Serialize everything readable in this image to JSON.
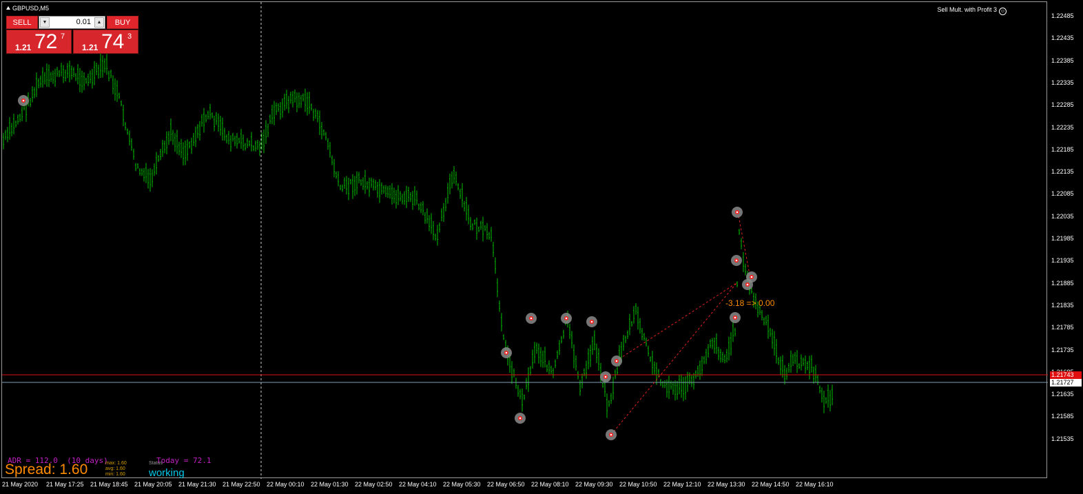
{
  "window": {
    "symbol_title": "GBPUSD,M5",
    "ea_label": "Sell Mult. with Profit 3",
    "ea_icon": "smiley-icon"
  },
  "trade_panel": {
    "sell_label": "SELL",
    "buy_label": "BUY",
    "lot_value": "0.01",
    "sell_price": {
      "prefix": "1.21",
      "big": "72",
      "sup": "7"
    },
    "buy_price": {
      "prefix": "1.21",
      "big": "74",
      "sup": "3"
    },
    "colors": {
      "button": "#e0262c"
    }
  },
  "price_axis": {
    "ticks": [
      "1.22485",
      "1.22435",
      "1.22385",
      "1.22335",
      "1.22285",
      "1.22235",
      "1.22185",
      "1.22135",
      "1.22085",
      "1.22035",
      "1.21985",
      "1.21935",
      "1.21885",
      "1.21835",
      "1.21785",
      "1.21735",
      "1.21685",
      "1.21635",
      "1.21585",
      "1.21535"
    ],
    "bid_line_label": "1.21743",
    "ask_line_label": "1.21727"
  },
  "time_axis": {
    "ticks": [
      "21 May 2020",
      "21 May 17:25",
      "21 May 18:45",
      "21 May 20:05",
      "21 May 21:30",
      "21 May 22:50",
      "22 May 00:10",
      "22 May 01:30",
      "22 May 02:50",
      "22 May 04:10",
      "22 May 05:30",
      "22 May 06:50",
      "22 May 08:10",
      "22 May 09:30",
      "22 May 10:50",
      "22 May 12:10",
      "22 May 13:30",
      "22 May 14:50",
      "22 May 16:10"
    ]
  },
  "indicators": {
    "adr_text": "ADR = 112.0  (10 days)",
    "today_text": "Today = 72.1",
    "spread_text": "Spread: 1.60",
    "spread_max": "max: 1.60",
    "spread_avg": "avg: 1.60",
    "spread_min": "min: 1.60",
    "status_label": "Status",
    "status_value": "working",
    "pnl_text": "-3.18 => 0.00",
    "colors": {
      "adr": "#c020c0",
      "spread": "#ff8c00",
      "status": "#00c8e8",
      "candles": "#00c000",
      "bid_line": "#e01010",
      "ask_line": "#7f9fb8"
    }
  }
}
